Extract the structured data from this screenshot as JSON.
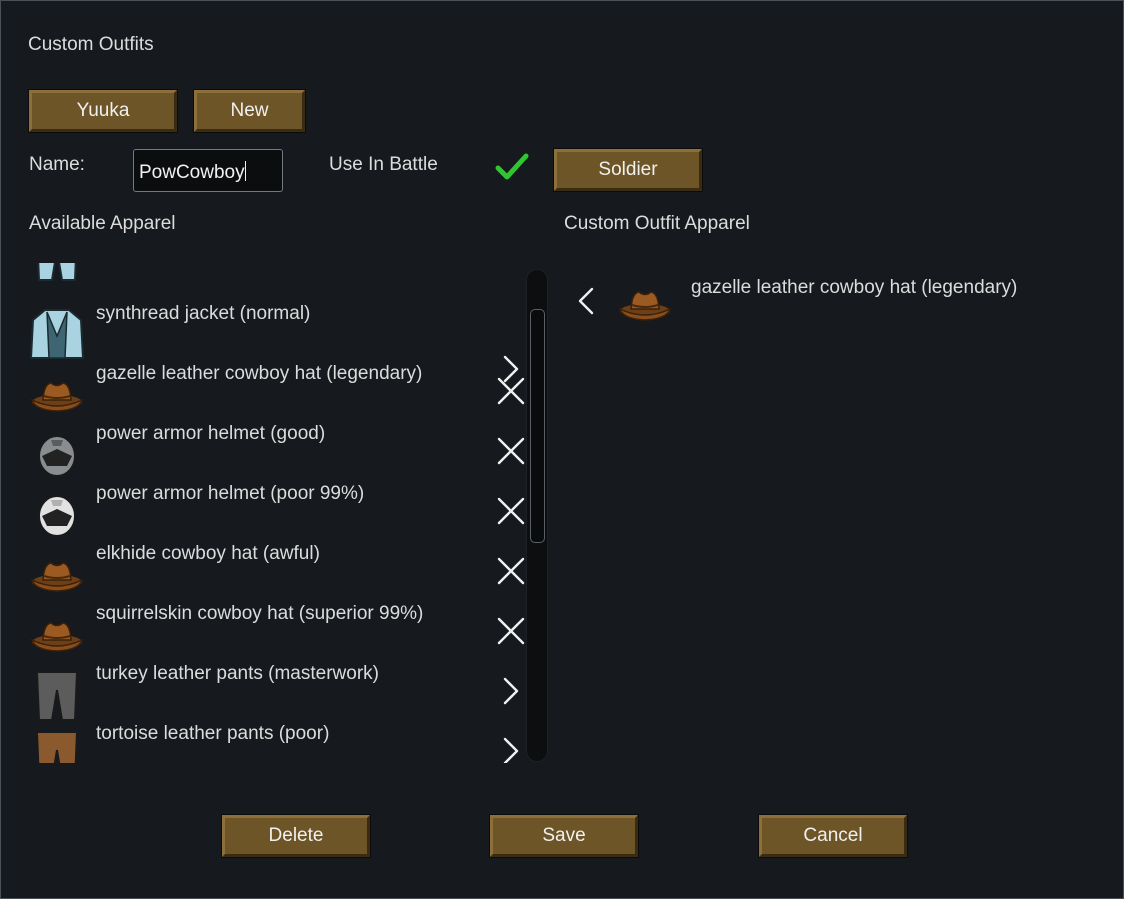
{
  "window": {
    "title": "Custom Outfits"
  },
  "outfit_buttons": [
    {
      "label": "Yuuka"
    },
    {
      "label": "New"
    }
  ],
  "name_label": "Name:",
  "name_input": {
    "value": "PowCowboy"
  },
  "use_in_battle": {
    "label": "Use In Battle",
    "checked": true,
    "check_color": "#2ec82e"
  },
  "role_button": {
    "label": "Soldier"
  },
  "available": {
    "header": "Available Apparel",
    "items": [
      {
        "label": "synthread jacket (normal)",
        "icon": "jacket-icon",
        "action": "add-arrow"
      },
      {
        "label": "gazelle leather cowboy hat (legendary)",
        "icon": "cowboy-hat-icon",
        "action": "remove-x"
      },
      {
        "label": "power armor helmet (good)",
        "icon": "power-helmet-icon",
        "action": "remove-x"
      },
      {
        "label": "power armor helmet (poor 99%)",
        "icon": "power-helmet-icon",
        "action": "remove-x"
      },
      {
        "label": "elkhide cowboy hat (awful)",
        "icon": "cowboy-hat-icon",
        "action": "remove-x"
      },
      {
        "label": "squirrelskin cowboy hat (superior 99%)",
        "icon": "cowboy-hat-icon",
        "action": "remove-x"
      },
      {
        "label": "turkey leather pants (masterwork)",
        "icon": "pants-icon",
        "action": "add-arrow"
      },
      {
        "label": "tortoise leather pants (poor)",
        "icon": "pants-icon",
        "action": "add-arrow"
      }
    ]
  },
  "custom": {
    "header": "Custom Outfit Apparel",
    "items": [
      {
        "label": "gazelle leather cowboy hat (legendary)",
        "icon": "cowboy-hat-icon",
        "action": "remove-arrow"
      }
    ]
  },
  "footer_buttons": {
    "delete": "Delete",
    "save": "Save",
    "cancel": "Cancel"
  },
  "colors": {
    "button_bg": "#6e5528",
    "background": "#16191e",
    "text": "#dcdcdc"
  }
}
